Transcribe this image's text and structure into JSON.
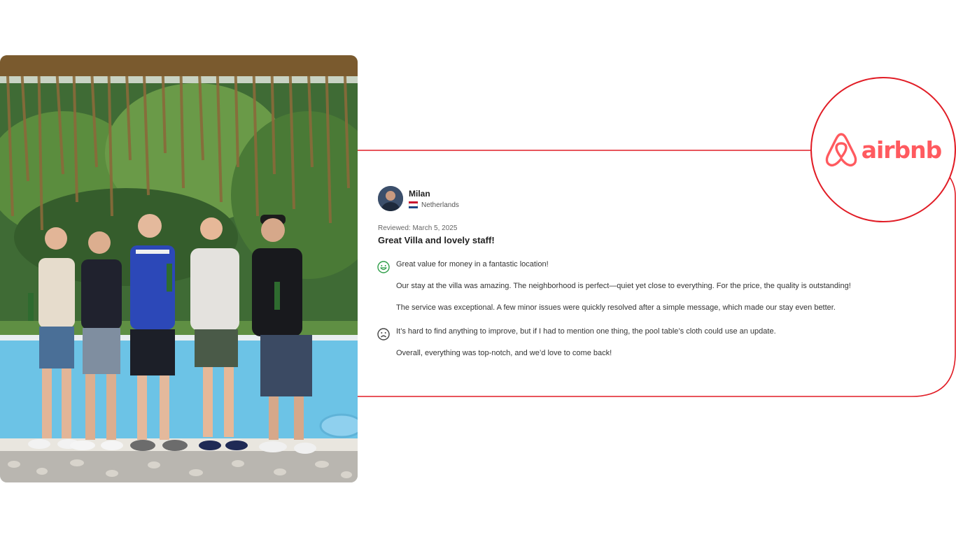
{
  "review": {
    "reviewer_name": "Milan",
    "reviewer_country": "Netherlands",
    "reviewed_date": "Reviewed: March 5, 2025",
    "title": "Great Villa and lovely staff!",
    "positive_icon": "smiling-face-icon",
    "negative_icon": "frowning-face-icon",
    "paragraphs": [
      "Great value for money in a fantastic location!",
      "Our stay at the villa was amazing. The neighborhood is perfect—quiet yet close to everything. For the price, the quality is outstanding!",
      "The service was exceptional. A few minor issues were quickly resolved after a simple message, which made our stay even better.",
      "It’s hard to find anything to improve, but if I had to mention one thing, the pool table’s cloth could use an update.",
      "Overall, everything was top-notch, and we’d love to come back!"
    ]
  },
  "brand": {
    "name": "airbnb",
    "logo_icon": "airbnb-belo-icon",
    "color": "#ff5a5f",
    "frame_color": "#e11d26"
  },
  "colors": {
    "positive": "#2e9e48",
    "negative": "#444444"
  },
  "photo": {
    "description_icon": "group-photo-by-pool"
  }
}
